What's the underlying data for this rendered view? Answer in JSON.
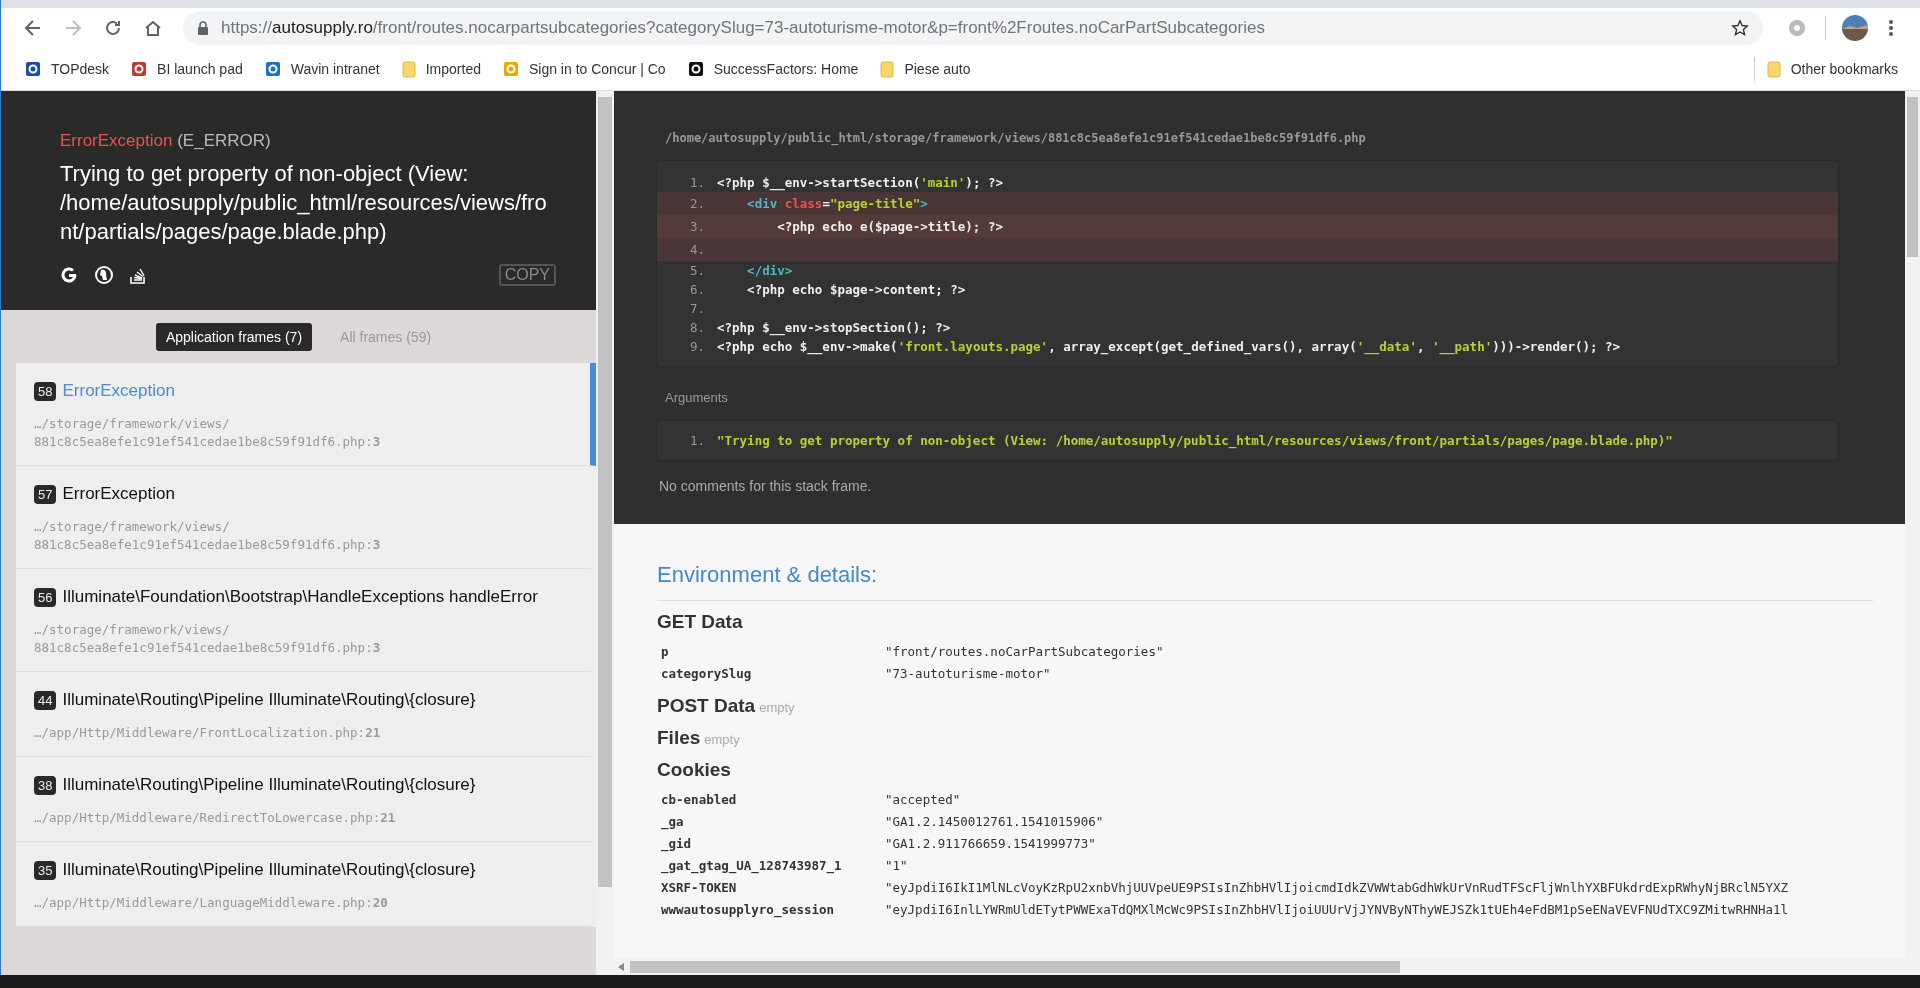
{
  "browser": {
    "nav": [
      {
        "kind": "back",
        "disabled": false
      },
      {
        "kind": "forward",
        "disabled": true
      },
      {
        "kind": "reload",
        "disabled": false
      },
      {
        "kind": "home",
        "disabled": false
      }
    ],
    "url": {
      "scheme": "https://",
      "domain": "autosupply.ro",
      "path": "/front/routes.nocarpartsubcategories?categorySlug=73-autoturisme-motor&p=front%2Froutes.noCarPartSubcategories"
    },
    "bookmarks": [
      {
        "label": "TOPdesk",
        "kind": "site",
        "color": "#1e4aa8"
      },
      {
        "label": "BI launch pad",
        "kind": "site",
        "color": "#c0392b"
      },
      {
        "label": "Wavin intranet",
        "kind": "site",
        "color": "#1f6fc5"
      },
      {
        "label": "Imported",
        "kind": "folder"
      },
      {
        "label": "Sign in to Concur | Co",
        "kind": "site",
        "color": "#f0a500"
      },
      {
        "label": "SuccessFactors: Home",
        "kind": "site",
        "color": "#111111"
      },
      {
        "label": "Piese auto",
        "kind": "folder"
      }
    ],
    "other_bookmarks": "Other bookmarks"
  },
  "error": {
    "class": "ErrorException",
    "code": "(E_ERROR)",
    "message": "Trying to get property of non-object (View: /home/autosupply/public_html/resources/views/front/partials/pages/page.blade.php)",
    "copy": "COPY"
  },
  "frame_tabs": [
    {
      "label": "Application frames (7)",
      "selected": true
    },
    {
      "label": "All frames (59)",
      "selected": false
    }
  ],
  "frames": [
    {
      "number": "58",
      "title": "ErrorException",
      "file": "…/storage/framework/views/ 881c8c5ea8efe1c91ef541cedae1be8c59f91df6.php:**3**",
      "selected": true
    },
    {
      "number": "57",
      "title": "ErrorException",
      "file": "…/storage/framework/views/ 881c8c5ea8efe1c91ef541cedae1be8c59f91df6.php:**3**",
      "selected": false
    },
    {
      "number": "56",
      "title": "Illuminate\\Foundation\\Bootstrap\\HandleExceptions handleError",
      "file": "…/storage/framework/views/ 881c8c5ea8efe1c91ef541cedae1be8c59f91df6.php:**3**",
      "selected": false
    },
    {
      "number": "44",
      "title": "Illuminate\\Routing\\Pipeline Illuminate\\Routing\\{closure}",
      "file": "…/app/Http/Middleware/FrontLocalization.php:**21**",
      "selected": false
    },
    {
      "number": "38",
      "title": "Illuminate\\Routing\\Pipeline Illuminate\\Routing\\{closure}",
      "file": "…/app/Http/Middleware/RedirectToLowercase.php:**21**",
      "selected": false
    },
    {
      "number": "35",
      "title": "Illuminate\\Routing\\Pipeline Illuminate\\Routing\\{closure}",
      "file": "…/app/Http/Middleware/LanguageMiddleware.php:**20**",
      "selected": false
    }
  ],
  "code": {
    "file": "/home/autosupply/public_html/storage/framework/views/881c8c5ea8efe1c91ef541cedae1be8c59f91df6.php",
    "lines": [
      {
        "number": "1.",
        "highlighted": false,
        "current": false,
        "tokens": [
          {
            "kind": "php",
            "text": "<?php $__env->startSection("
          },
          {
            "kind": "string",
            "text": "'main'"
          },
          {
            "kind": "php",
            "text": "); ?>"
          }
        ]
      },
      {
        "number": "2.",
        "highlighted": true,
        "current": false,
        "tokens": [
          {
            "kind": "tag",
            "text": "    <div "
          },
          {
            "kind": "attr",
            "text": "class"
          },
          {
            "kind": "php",
            "text": "="
          },
          {
            "kind": "string",
            "text": "\"page-title\""
          },
          {
            "kind": "tag",
            "text": ">"
          }
        ]
      },
      {
        "number": "3.",
        "highlighted": true,
        "current": true,
        "tokens": [
          {
            "kind": "php",
            "text": "        <?php echo e($page->title); ?>"
          }
        ]
      },
      {
        "number": "4.",
        "highlighted": true,
        "current": false
      },
      {
        "number": "5.",
        "highlighted": false,
        "current": false,
        "tokens": [
          {
            "kind": "tag",
            "text": "    </div>"
          }
        ]
      },
      {
        "number": "6.",
        "highlighted": false,
        "current": false,
        "tokens": [
          {
            "kind": "php",
            "text": "    <?php echo $page->content; ?>"
          }
        ]
      },
      {
        "number": "7.",
        "highlighted": false,
        "current": false
      },
      {
        "number": "8.",
        "highlighted": false,
        "current": false,
        "tokens": [
          {
            "kind": "php",
            "text": "<?php $__env->stopSection(); ?>"
          }
        ]
      },
      {
        "number": "9.",
        "highlighted": false,
        "current": false,
        "tokens": [
          {
            "kind": "php",
            "text": "<?php echo $__env->make("
          },
          {
            "kind": "string",
            "text": "'front.layouts.page'"
          },
          {
            "kind": "php",
            "text": ", array_except(get_defined_vars(), array("
          },
          {
            "kind": "string",
            "text": "'__data'"
          },
          {
            "kind": "php",
            "text": ", "
          },
          {
            "kind": "string",
            "text": "'__path'"
          },
          {
            "kind": "php",
            "text": ")))->render(); ?>"
          }
        ]
      }
    ]
  },
  "arguments": {
    "title": "Arguments",
    "items": [
      {
        "number": "1.",
        "value": "\"Trying to get property of non-object (View: /home/autosupply/public_html/resources/views/front/partials/pages/page.blade.php)\""
      }
    ]
  },
  "comments": "No comments for this stack frame.",
  "environment": {
    "title": "Environment & details:",
    "sections": [
      {
        "title": "GET Data",
        "rows": [
          {
            "key": "p",
            "value": "\"front/routes.noCarPartSubcategories\""
          },
          {
            "key": "categorySlug",
            "value": "\"73-autoturisme-motor\""
          }
        ]
      },
      {
        "title": "POST Data",
        "note": "empty"
      },
      {
        "title": "Files",
        "note": "empty"
      },
      {
        "title": "Cookies",
        "rows": [
          {
            "key": "cb-enabled",
            "value": "\"accepted\""
          },
          {
            "key": "_ga",
            "value": "\"GA1.2.1450012761.1541015906\""
          },
          {
            "key": "_gid",
            "value": "\"GA1.2.911766659.1541999773\""
          },
          {
            "key": "_gat_gtag_UA_128743987_1",
            "value": "\"1\""
          },
          {
            "key": "XSRF-TOKEN",
            "value": "\"eyJpdiI6IkI1MlNLcVoyKzRpU2xnbVhjUUVpeUE9PSIsInZhbHVlIjoicmdIdkZVWWtabGdhWkUrVnRudTFScFljWnlhYXBFUkdrdExpRWhyNjBRclN5YXZ"
          },
          {
            "key": "wwwautosupplyro_session",
            "value": "\"eyJpdiI6InlLYWRmUldETytPWWExaTdQMXlMcWc9PSIsInZhbHVlIjoiUUUrVjJYNVByNThyWEJSZk1tUEh4eFdBM1pSeENaVEVFNUdTXC9ZMitwRHNHa1l"
          }
        ]
      }
    ]
  }
}
